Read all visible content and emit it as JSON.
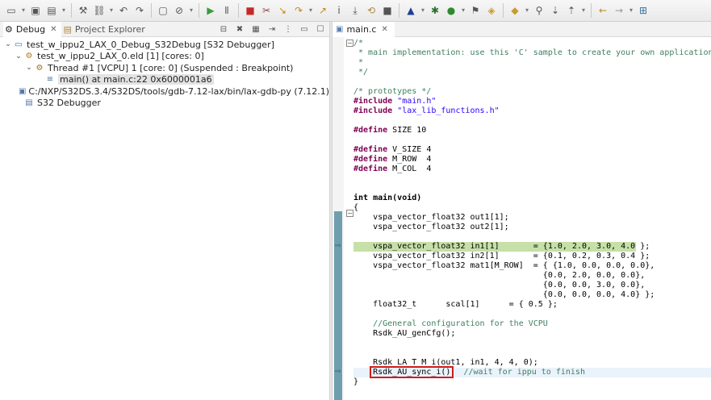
{
  "toolbar": {
    "icons": [
      "new-icon",
      "save-icon",
      "save-all-icon",
      "build-icon",
      "link-icon",
      "undo-icon",
      "redo-icon",
      "console-icon",
      "skip-breakpoints-icon",
      "resume-icon",
      "suspend-icon",
      "terminate-icon",
      "disconnect-icon",
      "step-into-icon",
      "step-over-icon",
      "step-return-icon",
      "instruction-step-icon",
      "drop-to-frame-icon",
      "run-last-icon",
      "stop-icon",
      "build-project-icon",
      "debug-icon",
      "run-icon",
      "external-tools-icon",
      "open-type-icon",
      "open-task-icon",
      "search-icon",
      "next-annotation-icon",
      "previous-annotation-icon",
      "back-icon",
      "forward-icon",
      "open-perspective-icon"
    ]
  },
  "left": {
    "tabs": [
      {
        "label": "Debug",
        "icon": "debug-icon",
        "active": true
      },
      {
        "label": "Project Explorer",
        "icon": "project-explorer-icon",
        "active": false
      }
    ],
    "tree": [
      {
        "text": "test_w_ippu2_LAX_0_Debug_S32Debug [S32 Debugger]",
        "indent": 0,
        "twisty": "v",
        "icon": "launch-config-icon",
        "selected": false
      },
      {
        "text": "test_w_ippu2_LAX_0.eld [1] [cores: 0]",
        "indent": 1,
        "twisty": "v",
        "icon": "debug-target-icon",
        "selected": false
      },
      {
        "text": "Thread #1 [VCPU] 1 [core: 0] (Suspended : Breakpoint)",
        "indent": 2,
        "twisty": "v",
        "icon": "thread-suspended-icon",
        "selected": false
      },
      {
        "text": "main() at main.c:22 0x6000001a6",
        "indent": 3,
        "twisty": "",
        "icon": "stack-frame-icon",
        "selected": true
      },
      {
        "text": "C:/NXP/S32DS.3.4/S32DS/tools/gdb-7.12-lax/bin/lax-gdb-py (7.12.1)",
        "indent": 1,
        "twisty": "",
        "icon": "gdb-process-icon",
        "selected": false
      },
      {
        "text": "S32 Debugger",
        "indent": 1,
        "twisty": "",
        "icon": "console-process-icon",
        "selected": false
      }
    ]
  },
  "editor": {
    "tab_label": "main.c",
    "lines": [
      "/*",
      " * main implementation: use this 'C' sample to create your own application",
      " *",
      " */",
      "",
      "/* prototypes */",
      "#include \"main.h\"",
      "#include \"lax_lib_functions.h\"",
      "",
      "#define SIZE 10",
      "",
      "#define V_SIZE 4",
      "#define M_ROW  4",
      "#define M_COL  4",
      "",
      "",
      "int main(void)",
      "{",
      "    vspa_vector_float32 out1[1];",
      "    vspa_vector_float32 out2[1];",
      "",
      "    vspa_vector_float32 in1[1]       = {1.0, 2.0, 3.0, 4.0 };",
      "    vspa_vector_float32 in2[1]       = {0.1, 0.2, 0.3, 0.4 };",
      "    vspa_vector_float32 mat1[M_ROW]  = { {1.0, 0.0, 0.0, 0.0},",
      "                                       {0.0, 2.0, 0.0, 0.0},",
      "                                       {0.0, 0.0, 3.0, 0.0},",
      "                                       {0.0, 0.0, 0.0, 4.0} };",
      "    float32_t      scal[1]      = { 0.5 };",
      "",
      "    //General configuration for the VCPU",
      "    Rsdk_AU_genCfg();",
      "",
      "",
      "    Rsdk_LA_T_M_i(out1, in1, 4, 4, 0);",
      "    Rsdk_AU_sync_i()",
      "}"
    ],
    "sync_comment": "  //wait for ippu to finish"
  }
}
